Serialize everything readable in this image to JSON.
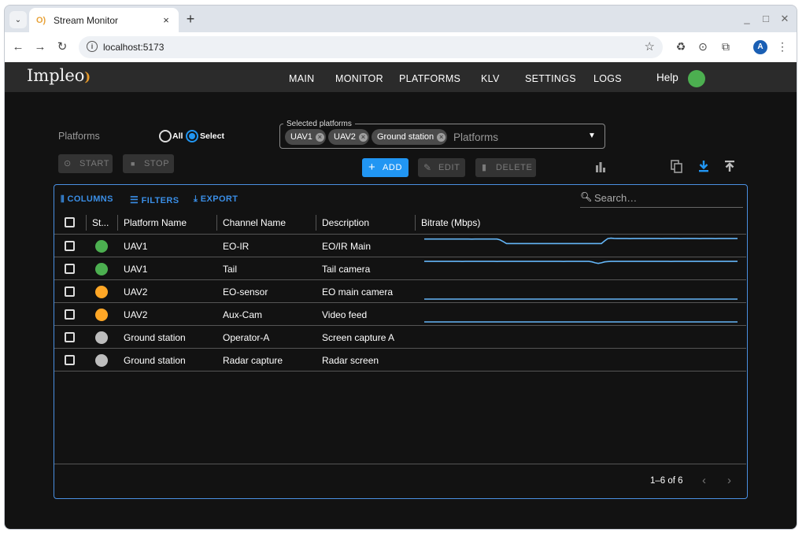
{
  "browser": {
    "tab_title": "Stream Monitor",
    "tab_close": "×",
    "new_tab": "+",
    "url": "localhost:5173",
    "profile_initial": "A"
  },
  "app": {
    "logo": "Impleo",
    "nav": [
      "MAIN",
      "MONITOR",
      "PLATFORMS",
      "KLV",
      "SETTINGS",
      "LOGS"
    ],
    "help": "Help",
    "status_color": "#4caf50"
  },
  "filters": {
    "platforms_label": "Platforms",
    "radio_all": "All",
    "radio_select": "Select",
    "selected_mode": "Select",
    "selector_legend": "Selected platforms",
    "chips": [
      "UAV1",
      "UAV2",
      "Ground station"
    ],
    "placeholder": "Platforms"
  },
  "actions": {
    "start": "START",
    "stop": "STOP",
    "add": "ADD",
    "edit": "EDIT",
    "delete": "DELETE"
  },
  "grid": {
    "toolbar": {
      "columns": "COLUMNS",
      "filters": "FILTERS",
      "export": "EXPORT"
    },
    "search_placeholder": "Search…",
    "headers": [
      "St...",
      "Platform Name",
      "Channel Name",
      "Description",
      "Bitrate (Mbps)"
    ],
    "rows": [
      {
        "status": "green",
        "platform": "UAV1",
        "channel": "EO-IR",
        "description": "EO/IR Main",
        "bitrate": [
          3.2,
          3.2,
          3.21,
          3.2,
          3.21,
          3.2,
          3.2,
          3.21,
          3.2,
          3.2,
          3.2,
          3.2,
          3.21,
          3.2,
          3.2,
          3.19,
          3.2,
          3.21,
          3.2,
          3.2,
          3.2,
          3.2,
          3.21,
          3.2,
          3.0,
          2.6,
          2.2,
          2.2,
          2.2,
          2.2,
          2.2,
          2.2,
          2.2,
          2.2,
          2.2,
          2.2,
          2.2,
          2.2,
          2.2,
          2.2,
          2.2,
          2.2,
          2.2,
          2.2,
          2.2,
          2.2,
          2.2,
          2.2,
          2.2,
          2.2,
          2.2,
          2.2,
          2.2,
          2.2,
          2.2,
          2.2,
          2.2,
          2.8,
          3.3,
          3.4,
          3.35,
          3.3,
          3.3,
          3.31,
          3.3,
          3.29,
          3.3,
          3.31,
          3.3,
          3.3,
          3.32,
          3.3,
          3.3,
          3.31,
          3.3,
          3.29,
          3.3,
          3.3,
          3.31,
          3.3,
          3.3,
          3.29,
          3.3,
          3.31,
          3.3,
          3.3,
          3.3,
          3.29,
          3.31,
          3.3,
          3.3,
          3.3,
          3.29,
          3.3,
          3.3,
          3.31,
          3.3,
          3.3,
          3.3,
          3.3
        ]
      },
      {
        "status": "green",
        "platform": "UAV1",
        "channel": "Tail",
        "description": "Tail camera",
        "bitrate": [
          3.3,
          3.3,
          3.31,
          3.3,
          3.3,
          3.3,
          3.3,
          3.3,
          3.31,
          3.3,
          3.3,
          3.3,
          3.29,
          3.3,
          3.3,
          3.3,
          3.3,
          3.3,
          3.3,
          3.31,
          3.3,
          3.3,
          3.3,
          3.29,
          3.3,
          3.3,
          3.3,
          3.3,
          3.31,
          3.3,
          3.3,
          3.3,
          3.3,
          3.3,
          3.3,
          3.3,
          3.3,
          3.3,
          3.3,
          3.31,
          3.3,
          3.3,
          3.3,
          3.3,
          3.29,
          3.3,
          3.3,
          3.3,
          3.3,
          3.3,
          3.3,
          3.3,
          3.3,
          3.2,
          3.0,
          2.85,
          3.0,
          3.2,
          3.28,
          3.3,
          3.3,
          3.3,
          3.31,
          3.3,
          3.3,
          3.3,
          3.3,
          3.3,
          3.3,
          3.3,
          3.31,
          3.3,
          3.3,
          3.3,
          3.3,
          3.3,
          3.3,
          3.3,
          3.29,
          3.3,
          3.3,
          3.3,
          3.31,
          3.3,
          3.3,
          3.3,
          3.3,
          3.3,
          3.3,
          3.3,
          3.3,
          3.31,
          3.3,
          3.3,
          3.3,
          3.3,
          3.3,
          3.3,
          3.3,
          3.31
        ]
      },
      {
        "status": "orange",
        "platform": "UAV2",
        "channel": "EO-sensor",
        "description": "EO main camera",
        "bitrate": [
          0,
          0,
          0,
          0,
          0,
          0,
          0,
          0,
          0,
          0,
          0,
          0,
          0,
          0,
          0,
          0,
          0,
          0,
          0,
          0,
          0,
          0,
          0,
          0,
          0,
          0,
          0,
          0,
          0,
          0,
          0,
          0,
          0,
          0,
          0,
          0,
          0,
          0,
          0,
          0,
          0,
          0,
          0,
          0,
          0,
          0,
          0,
          0,
          0,
          0,
          0,
          0,
          0,
          0,
          0,
          0,
          0,
          0,
          0,
          0,
          0,
          0,
          0,
          0,
          0,
          0,
          0,
          0,
          0,
          0,
          0,
          0,
          0,
          0,
          0,
          0,
          0,
          0,
          0,
          0,
          0,
          0,
          0,
          0,
          0,
          0,
          0,
          0,
          0,
          0,
          0,
          0,
          0,
          0,
          0,
          0,
          0,
          0,
          0,
          0
        ]
      },
      {
        "status": "orange",
        "platform": "UAV2",
        "channel": "Aux-Cam",
        "description": "Video feed",
        "bitrate": [
          0,
          0,
          0,
          0,
          0,
          0,
          0,
          0,
          0,
          0,
          0,
          0,
          0,
          0,
          0,
          0,
          0,
          0,
          0,
          0,
          0,
          0,
          0,
          0,
          0,
          0,
          0,
          0,
          0,
          0,
          0,
          0,
          0,
          0,
          0,
          0,
          0,
          0,
          0,
          0,
          0,
          0,
          0,
          0,
          0,
          0,
          0,
          0,
          0,
          0,
          0,
          0,
          0,
          0,
          0,
          0,
          0,
          0,
          0,
          0,
          0,
          0,
          0,
          0,
          0,
          0,
          0,
          0,
          0,
          0,
          0,
          0,
          0,
          0,
          0,
          0,
          0,
          0,
          0,
          0,
          0,
          0,
          0,
          0,
          0,
          0,
          0,
          0,
          0,
          0,
          0,
          0,
          0,
          0,
          0,
          0,
          0,
          0,
          0,
          0
        ]
      },
      {
        "status": "gray",
        "platform": "Ground station",
        "channel": "Operator-A",
        "description": "Screen capture A",
        "bitrate": []
      },
      {
        "status": "gray",
        "platform": "Ground station",
        "channel": "Radar capture",
        "description": "Radar screen",
        "bitrate": []
      }
    ],
    "status_colors": {
      "green": "#4caf50",
      "orange": "#ffa726",
      "gray": "#bdbdbd"
    },
    "spark_color": "#64b5f6",
    "pagination": "1–6 of 6"
  }
}
